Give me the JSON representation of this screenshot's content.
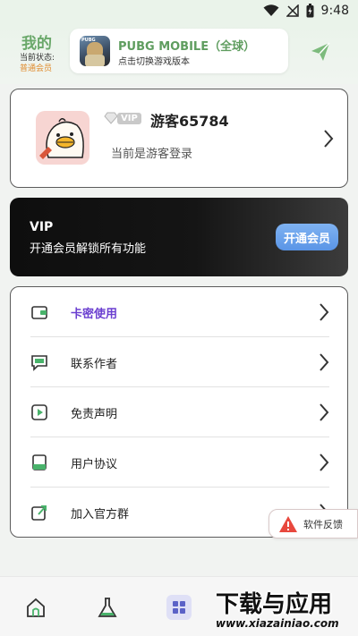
{
  "status_bar": {
    "time": "9:48",
    "icons": [
      "wifi-icon",
      "no-signal-icon",
      "battery-icon"
    ]
  },
  "header": {
    "title": "我的",
    "state_label": "当前状态:",
    "state_value": "普通会员",
    "game": {
      "name": "PUBG MOBILE（全球）",
      "subtitle": "点击切换游戏版本",
      "logo_text": "PUBG"
    }
  },
  "profile": {
    "vip_tag": "VIP",
    "name": "游客65784",
    "subtitle": "当前是游客登录"
  },
  "vip_banner": {
    "title": "VIP",
    "subtitle": "开通会员解锁所有功能",
    "button": "开通会员"
  },
  "menu": {
    "items": [
      {
        "label": "卡密使用",
        "icon": "wallet-icon",
        "active": true
      },
      {
        "label": "联系作者",
        "icon": "chat-icon",
        "active": false
      },
      {
        "label": "免责声明",
        "icon": "play-icon",
        "active": false
      },
      {
        "label": "用户协议",
        "icon": "book-icon",
        "active": false
      },
      {
        "label": "加入官方群",
        "icon": "share-icon",
        "active": false
      }
    ]
  },
  "feedback": {
    "label": "软件反馈"
  },
  "bottom_nav": {
    "items": [
      "home-icon",
      "flask-icon",
      "grid-icon"
    ]
  },
  "watermark": {
    "main": "下载与应用",
    "url": "www.xiazainiao.com"
  },
  "colors": {
    "accent_green": "#5f9d5f",
    "active_purple": "#6b3fd0",
    "vip_button": "#5a95e6",
    "state_orange": "#e08b2e"
  }
}
